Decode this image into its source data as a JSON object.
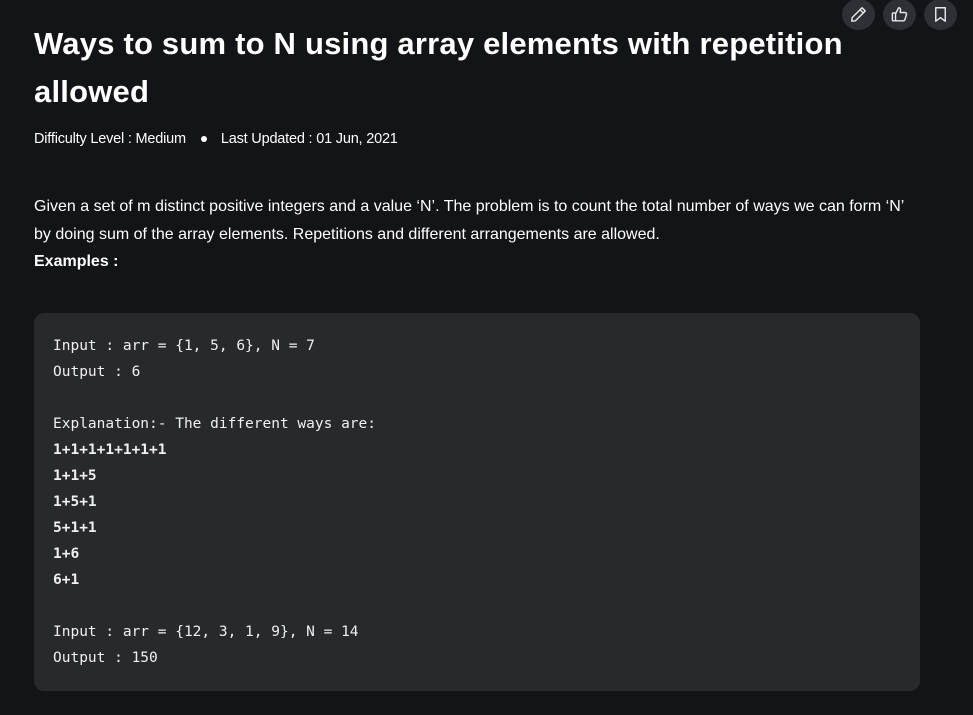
{
  "actions": [
    {
      "name": "edit-button",
      "icon": "pencil-icon"
    },
    {
      "name": "like-button",
      "icon": "thumbs-up-icon"
    },
    {
      "name": "bookmark-button",
      "icon": "bookmark-icon"
    }
  ],
  "article": {
    "title": "Ways to sum to N using array elements with repetition allowed",
    "difficulty": "Difficulty Level : Medium",
    "last_updated": "Last Updated : 01 Jun, 2021",
    "description": "Given a set of m distinct positive integers and a value ‘N’. The problem is to count the total number of ways we can form ‘N’ by doing sum of the array elements. Repetitions and different arrangements are allowed.",
    "examples_heading": "Examples :"
  },
  "code_example": {
    "lines": [
      "Input : arr = {1, 5, 6}, N = 7",
      "Output : 6",
      "",
      "Explanation:- The different ways are:",
      "1+1+1+1+1+1+1",
      "1+1+5",
      "1+5+1",
      "5+1+1",
      "1+6",
      "6+1",
      "",
      "Input : arr = {12, 3, 1, 9}, N = 14",
      "Output : 150"
    ]
  },
  "colors": {
    "background": "#131417",
    "code_background": "#28292d",
    "icon_button_background": "#2e3036",
    "text": "#ffffff"
  }
}
